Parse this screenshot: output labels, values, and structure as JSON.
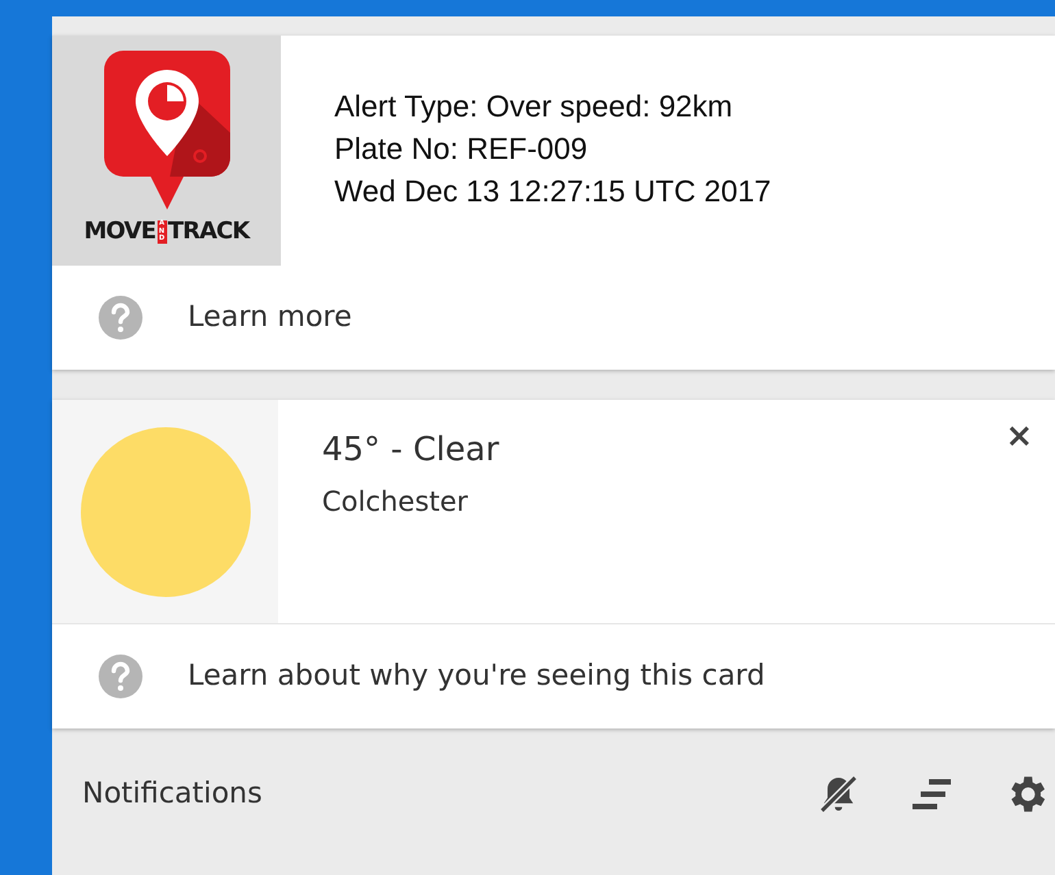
{
  "cards": [
    {
      "kind": "alert",
      "logo": {
        "word_1": "MOVE",
        "word_2": "AND",
        "word_3": "TRACK"
      },
      "lines": [
        "Alert Type: Over speed: 92km",
        "Plate No: REF-009",
        "Wed Dec 13 12:27:15 UTC 2017"
      ],
      "link": "Learn more"
    },
    {
      "kind": "weather",
      "title": "45° - Clear",
      "subtitle": "Colchester",
      "link": "Learn about why you're seeing this card",
      "close": "×"
    }
  ],
  "footer": {
    "title": "Notifications"
  }
}
